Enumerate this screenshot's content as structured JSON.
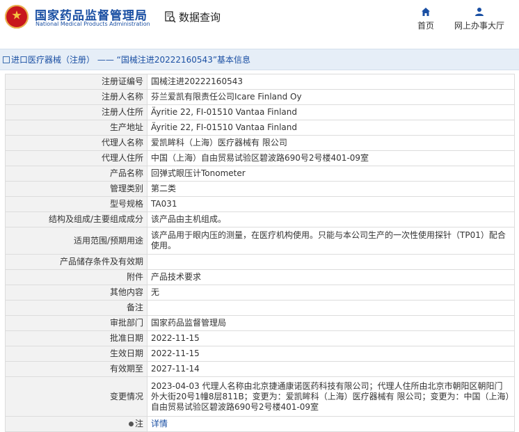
{
  "header": {
    "logo_cn": "国家药品监督管理局",
    "logo_en": "National Medical Products Administration",
    "query_label": "数据查询",
    "nav": [
      {
        "label": "首页",
        "icon": "home-icon"
      },
      {
        "label": "网上办事大厅",
        "icon": "user-icon"
      }
    ]
  },
  "breadcrumb": "进口医疗器械（注册） —— “国械注进20222160543”基本信息",
  "rows": [
    {
      "key": "注册证编号",
      "value": "国械注进20222160543"
    },
    {
      "key": "注册人名称",
      "value": "芬兰爱凯有限责任公司Icare Finland Oy"
    },
    {
      "key": "注册人住所",
      "value": "Äyritie 22, FI-01510 Vantaa Finland"
    },
    {
      "key": "生产地址",
      "value": "Äyritie 22, FI-01510 Vantaa Finland"
    },
    {
      "key": "代理人名称",
      "value": "爱凯眸科（上海）医疗器械有 限公司"
    },
    {
      "key": "代理人住所",
      "value": "中国（上海）自由贸易试验区碧波路690号2号楼401-09室"
    },
    {
      "key": "产品名称",
      "value": "回弹式眼压计Tonometer"
    },
    {
      "key": "管理类别",
      "value": "第二类"
    },
    {
      "key": "型号规格",
      "value": "TA031"
    },
    {
      "key": "结构及组成/主要组成成分",
      "value": "该产品由主机组成。"
    },
    {
      "key": "适用范围/预期用途",
      "value": "该产品用于眼内压的测量，在医疗机构使用。只能与本公司生产的一次性使用探针（TP01）配合使用。"
    },
    {
      "key": "产品储存条件及有效期",
      "value": ""
    },
    {
      "key": "附件",
      "value": "产品技术要求"
    },
    {
      "key": "其他内容",
      "value": "无"
    },
    {
      "key": "备注",
      "value": ""
    },
    {
      "key": "审批部门",
      "value": "国家药品监督管理局"
    },
    {
      "key": "批准日期",
      "value": "2022-11-15"
    },
    {
      "key": "生效日期",
      "value": "2022-11-15"
    },
    {
      "key": "有效期至",
      "value": "2027-11-14"
    },
    {
      "key": "变更情况",
      "value": "2023-04-03 代理人名称由北京捷通康诺医药科技有限公司；代理人住所由北京市朝阳区朝阳门外大街20号1幢8层811B；变更为：爱凯眸科（上海）医疗器械有 限公司；变更为：中国（上海）自由贸易试验区碧波路690号2号楼401-09室"
    }
  ],
  "note": {
    "key": "注",
    "link": "详情",
    "icon": "note-icon"
  }
}
